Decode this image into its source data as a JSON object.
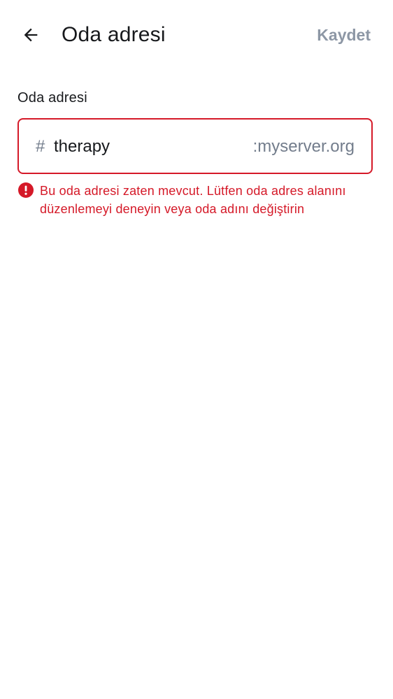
{
  "header": {
    "title": "Oda adresi",
    "save_label": "Kaydet",
    "back_icon": "arrow-left-icon"
  },
  "field": {
    "label": "Oda adresi",
    "prefix": "#",
    "value": "therapy",
    "suffix": ":myserver.org"
  },
  "error": {
    "icon": "error-icon",
    "message": "Bu oda adresi zaten mevcut. Lütfen oda adres alanını düzenlemeyi deneyin veya oda adını değiştirin"
  },
  "colors": {
    "error": "#d51928",
    "muted": "#737d8c",
    "disabled_action": "#8d97a5",
    "text": "#17191c"
  }
}
